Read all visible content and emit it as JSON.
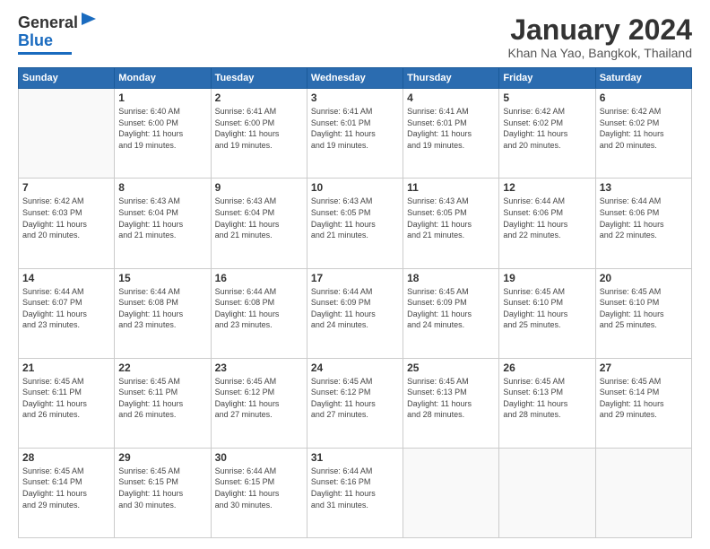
{
  "logo": {
    "line1": "General",
    "line2": "Blue"
  },
  "header": {
    "month": "January 2024",
    "location": "Khan Na Yao, Bangkok, Thailand"
  },
  "days_of_week": [
    "Sunday",
    "Monday",
    "Tuesday",
    "Wednesday",
    "Thursday",
    "Friday",
    "Saturday"
  ],
  "weeks": [
    [
      {
        "day": "",
        "info": ""
      },
      {
        "day": "1",
        "info": "Sunrise: 6:40 AM\nSunset: 6:00 PM\nDaylight: 11 hours\nand 19 minutes."
      },
      {
        "day": "2",
        "info": "Sunrise: 6:41 AM\nSunset: 6:00 PM\nDaylight: 11 hours\nand 19 minutes."
      },
      {
        "day": "3",
        "info": "Sunrise: 6:41 AM\nSunset: 6:01 PM\nDaylight: 11 hours\nand 19 minutes."
      },
      {
        "day": "4",
        "info": "Sunrise: 6:41 AM\nSunset: 6:01 PM\nDaylight: 11 hours\nand 19 minutes."
      },
      {
        "day": "5",
        "info": "Sunrise: 6:42 AM\nSunset: 6:02 PM\nDaylight: 11 hours\nand 20 minutes."
      },
      {
        "day": "6",
        "info": "Sunrise: 6:42 AM\nSunset: 6:02 PM\nDaylight: 11 hours\nand 20 minutes."
      }
    ],
    [
      {
        "day": "7",
        "info": "Sunrise: 6:42 AM\nSunset: 6:03 PM\nDaylight: 11 hours\nand 20 minutes."
      },
      {
        "day": "8",
        "info": "Sunrise: 6:43 AM\nSunset: 6:04 PM\nDaylight: 11 hours\nand 21 minutes."
      },
      {
        "day": "9",
        "info": "Sunrise: 6:43 AM\nSunset: 6:04 PM\nDaylight: 11 hours\nand 21 minutes."
      },
      {
        "day": "10",
        "info": "Sunrise: 6:43 AM\nSunset: 6:05 PM\nDaylight: 11 hours\nand 21 minutes."
      },
      {
        "day": "11",
        "info": "Sunrise: 6:43 AM\nSunset: 6:05 PM\nDaylight: 11 hours\nand 21 minutes."
      },
      {
        "day": "12",
        "info": "Sunrise: 6:44 AM\nSunset: 6:06 PM\nDaylight: 11 hours\nand 22 minutes."
      },
      {
        "day": "13",
        "info": "Sunrise: 6:44 AM\nSunset: 6:06 PM\nDaylight: 11 hours\nand 22 minutes."
      }
    ],
    [
      {
        "day": "14",
        "info": "Sunrise: 6:44 AM\nSunset: 6:07 PM\nDaylight: 11 hours\nand 23 minutes."
      },
      {
        "day": "15",
        "info": "Sunrise: 6:44 AM\nSunset: 6:08 PM\nDaylight: 11 hours\nand 23 minutes."
      },
      {
        "day": "16",
        "info": "Sunrise: 6:44 AM\nSunset: 6:08 PM\nDaylight: 11 hours\nand 23 minutes."
      },
      {
        "day": "17",
        "info": "Sunrise: 6:44 AM\nSunset: 6:09 PM\nDaylight: 11 hours\nand 24 minutes."
      },
      {
        "day": "18",
        "info": "Sunrise: 6:45 AM\nSunset: 6:09 PM\nDaylight: 11 hours\nand 24 minutes."
      },
      {
        "day": "19",
        "info": "Sunrise: 6:45 AM\nSunset: 6:10 PM\nDaylight: 11 hours\nand 25 minutes."
      },
      {
        "day": "20",
        "info": "Sunrise: 6:45 AM\nSunset: 6:10 PM\nDaylight: 11 hours\nand 25 minutes."
      }
    ],
    [
      {
        "day": "21",
        "info": "Sunrise: 6:45 AM\nSunset: 6:11 PM\nDaylight: 11 hours\nand 26 minutes."
      },
      {
        "day": "22",
        "info": "Sunrise: 6:45 AM\nSunset: 6:11 PM\nDaylight: 11 hours\nand 26 minutes."
      },
      {
        "day": "23",
        "info": "Sunrise: 6:45 AM\nSunset: 6:12 PM\nDaylight: 11 hours\nand 27 minutes."
      },
      {
        "day": "24",
        "info": "Sunrise: 6:45 AM\nSunset: 6:12 PM\nDaylight: 11 hours\nand 27 minutes."
      },
      {
        "day": "25",
        "info": "Sunrise: 6:45 AM\nSunset: 6:13 PM\nDaylight: 11 hours\nand 28 minutes."
      },
      {
        "day": "26",
        "info": "Sunrise: 6:45 AM\nSunset: 6:13 PM\nDaylight: 11 hours\nand 28 minutes."
      },
      {
        "day": "27",
        "info": "Sunrise: 6:45 AM\nSunset: 6:14 PM\nDaylight: 11 hours\nand 29 minutes."
      }
    ],
    [
      {
        "day": "28",
        "info": "Sunrise: 6:45 AM\nSunset: 6:14 PM\nDaylight: 11 hours\nand 29 minutes."
      },
      {
        "day": "29",
        "info": "Sunrise: 6:45 AM\nSunset: 6:15 PM\nDaylight: 11 hours\nand 30 minutes."
      },
      {
        "day": "30",
        "info": "Sunrise: 6:44 AM\nSunset: 6:15 PM\nDaylight: 11 hours\nand 30 minutes."
      },
      {
        "day": "31",
        "info": "Sunrise: 6:44 AM\nSunset: 6:16 PM\nDaylight: 11 hours\nand 31 minutes."
      },
      {
        "day": "",
        "info": ""
      },
      {
        "day": "",
        "info": ""
      },
      {
        "day": "",
        "info": ""
      }
    ]
  ]
}
